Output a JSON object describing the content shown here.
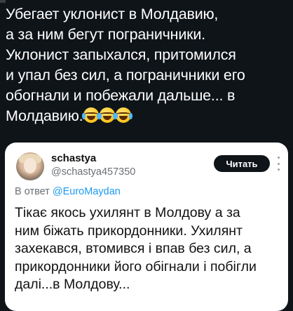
{
  "post": {
    "lines": [
      "Убегает уклонист в Молдавию,",
      "а за ним бегут пограничники.",
      "Уклонист запыхался, притомился",
      "и упал без сил, а пограничники его",
      "обогнали и побежали дальше... в",
      "Молдавию."
    ],
    "emoji_icon": "face-with-tears-of-joy-icon",
    "emoji_count": 3
  },
  "quoted_tweet": {
    "display_name": "schastya",
    "handle": "@schastya457350",
    "read_button_label": "Читать",
    "reply_prefix": "В ответ",
    "reply_mention": "@EuroMaydan",
    "lines": [
      "Тікає якось ухилянт в Молдову а за",
      "ним біжать прикордонники. Ухилянт",
      "захекався, втомився і впав без сил, а",
      "прикордонники його обігнали і побігли",
      "далі...в Молдову..."
    ]
  },
  "colors": {
    "background": "#0f1419",
    "card": "#ffffff",
    "button": "#0f1419",
    "mention": "#1d9bf0",
    "muted": "#6b7075"
  }
}
